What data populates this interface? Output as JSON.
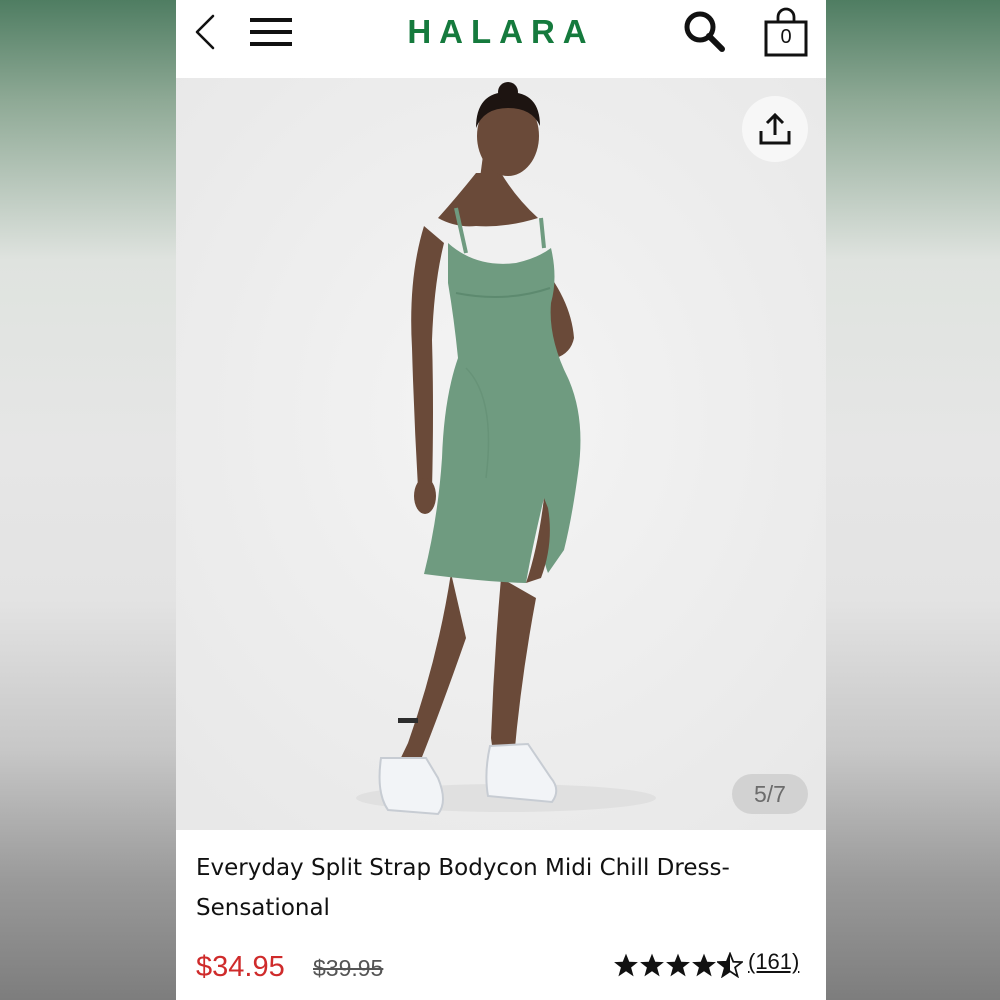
{
  "header": {
    "brand": "HALARA",
    "cart_count": "0",
    "icons": [
      "back-chevron-icon",
      "hamburger-menu-icon",
      "search-icon",
      "shopping-bag-icon"
    ]
  },
  "gallery": {
    "image_counter": "5/7",
    "share_icon": "share-upload-icon",
    "dress_color": "#6f9b80"
  },
  "product": {
    "title": "Everyday Split Strap Bodycon Midi Chill Dress-Sensational",
    "sale_price": "$34.95",
    "original_price": "$39.95",
    "rating_stars": 4.5,
    "review_count": "(161)"
  },
  "colors": {
    "brand_green": "#157a3d",
    "sale_red": "#cf2b2b"
  }
}
